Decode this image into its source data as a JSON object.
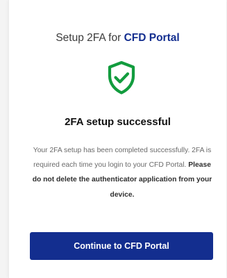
{
  "colors": {
    "brand": "#132e8f",
    "success": "#129c3e",
    "text_muted": "#6a6a6a"
  },
  "header": {
    "title_prefix": "Setup 2FA for",
    "brand_name": "CFD Portal"
  },
  "status": {
    "icon": "shield-check-icon",
    "heading": "2FA setup successful"
  },
  "message": {
    "body": "Your 2FA setup has been completed successfully. 2FA is required each time you login to your CFD Portal.",
    "warning": "Please do not delete the authenticator application from your device."
  },
  "actions": {
    "continue_label": "Continue to CFD Portal"
  }
}
